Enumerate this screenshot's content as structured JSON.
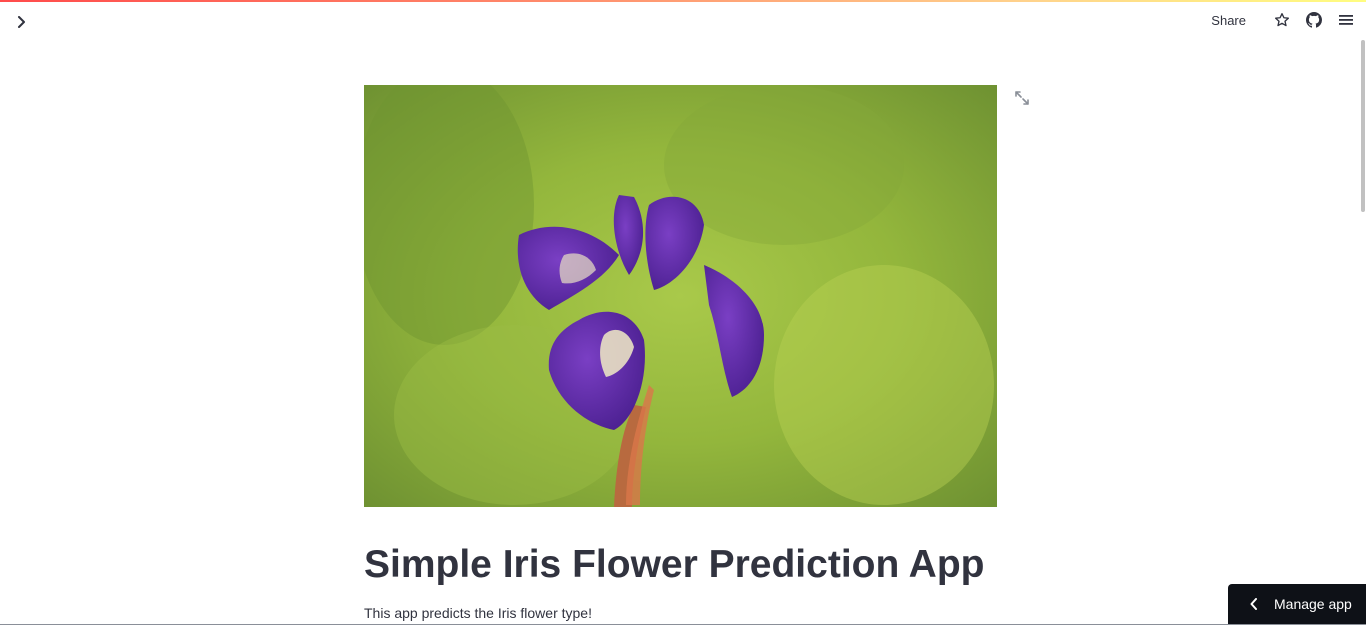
{
  "header": {
    "share_label": "Share",
    "icons": [
      "chevron-right-icon",
      "star-icon",
      "github-icon",
      "hamburger-menu-icon"
    ]
  },
  "main": {
    "title": "Simple Iris Flower Prediction App",
    "subtitle": "This app predicts the Iris flower type!"
  },
  "manage_app": {
    "label": "Manage app"
  },
  "colors": {
    "text": "#31333f",
    "accent": "#ff4b4b",
    "manage_bg": "#0e1117"
  }
}
